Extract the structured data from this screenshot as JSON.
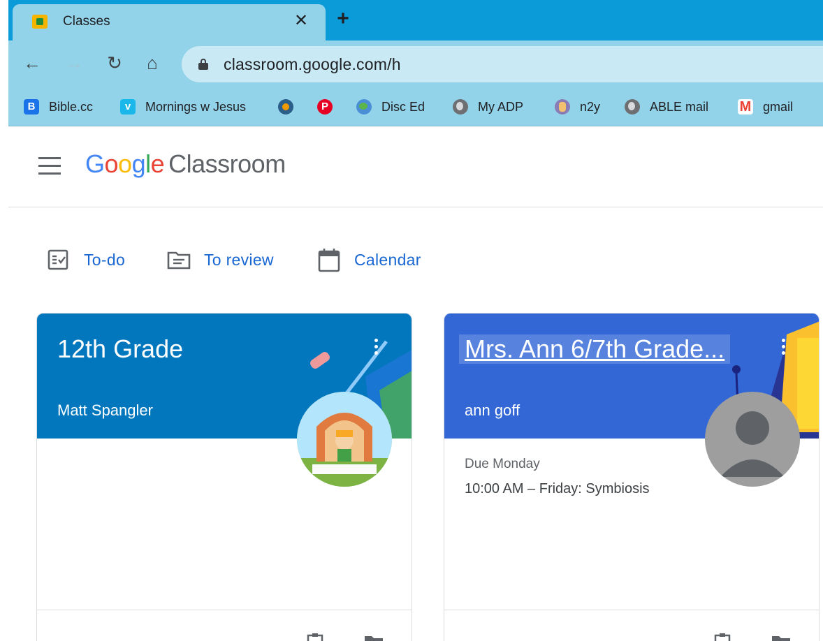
{
  "browser": {
    "tab": {
      "title": "Classes",
      "close": "✕"
    },
    "new_tab": "+",
    "nav": {
      "back": "←",
      "forward": "→",
      "reload": "↻",
      "home": "⌂"
    },
    "url": "classroom.google.com/h",
    "bookmarks": [
      {
        "label": "Bible.cc",
        "icon": "bible-cc-icon",
        "color": "#1a73e8"
      },
      {
        "label": "Mornings w Jesus",
        "icon": "vimeo-icon",
        "color": "#1ab7ea"
      },
      {
        "label": "",
        "icon": "media-icon",
        "color": "#2b5f8a"
      },
      {
        "label": "",
        "icon": "pinterest-icon",
        "color": "#e60023"
      },
      {
        "label": "Disc Ed",
        "icon": "globe-icon",
        "color": "#4a8fd6"
      },
      {
        "label": "My ADP",
        "icon": "world-icon",
        "color": "#6d6f72"
      },
      {
        "label": "n2y",
        "icon": "n2y-icon",
        "color": "#8a7db5"
      },
      {
        "label": "ABLE mail",
        "icon": "world-icon",
        "color": "#6d6f72"
      },
      {
        "label": "gmail",
        "icon": "gmail-icon",
        "color": "#ea4335"
      }
    ]
  },
  "app": {
    "logo": {
      "g1": "G",
      "g2": "o",
      "g3": "o",
      "g4": "g",
      "g5": "l",
      "g6": "e",
      "product": "Classroom"
    }
  },
  "quick_links": {
    "todo": "To-do",
    "review": "To review",
    "calendar": "Calendar"
  },
  "cards": [
    {
      "title": "12th Grade",
      "teacher": "Matt Spangler",
      "header_color": "#0277bd",
      "due_label": "",
      "due_item": ""
    },
    {
      "title": "Mrs. Ann 6/7th Grade...",
      "teacher": "ann goff",
      "header_color": "#3367d6",
      "due_label": "Due Monday",
      "due_item": "10:00 AM – Friday: Symbiosis"
    }
  ],
  "colors": {
    "chrome_tabstrip": "#0a9bd8",
    "chrome_toolbar": "#93d3ea",
    "link_blue": "#1967d2"
  }
}
